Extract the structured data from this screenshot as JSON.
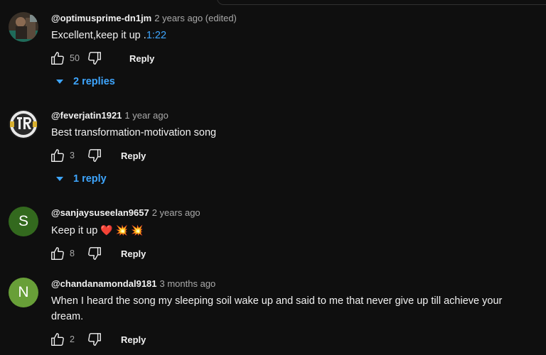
{
  "comments": [
    {
      "handle": "@optimusprime-dn1jm",
      "time": "2 years ago (edited)",
      "text": "Excellent,keep it up .",
      "timestamp_link": "1:22",
      "likes": "50",
      "reply_label": "Reply",
      "replies_label": "2 replies"
    },
    {
      "handle": "@feverjatin1921",
      "time": "1 year ago",
      "text": "Best transformation-motivation song",
      "likes": "3",
      "reply_label": "Reply",
      "replies_label": "1 reply"
    },
    {
      "handle": "@sanjaysuseelan9657",
      "time": "2 years ago",
      "text": "Keep it up",
      "emojis": "❤️ 💥 💥",
      "avatar_letter": "S",
      "avatar_color": "#33691e",
      "likes": "8",
      "reply_label": "Reply"
    },
    {
      "handle": "@chandanamondal9181",
      "time": "3 months ago",
      "text": "When I heard the song my sleeping soil  wake  up and said to me that never give up till achieve your dream.",
      "avatar_letter": "N",
      "avatar_color": "#689f38",
      "likes": "2",
      "reply_label": "Reply"
    }
  ],
  "colors": {
    "background": "#0f0f0f",
    "link": "#3ea6ff",
    "secondary_text": "#aaaaaa"
  },
  "icons": [
    "thumbs-up-icon",
    "thumbs-down-icon",
    "caret-down-icon"
  ]
}
